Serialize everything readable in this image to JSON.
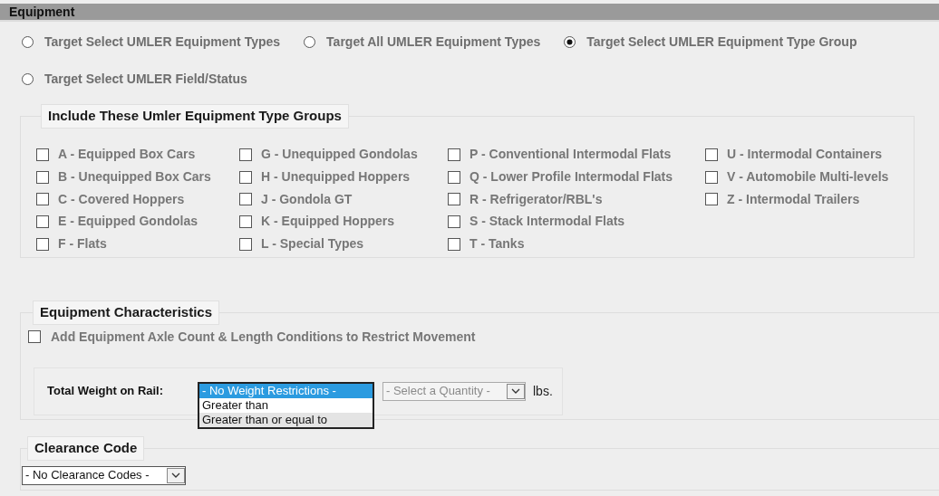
{
  "section_header": "Equipment",
  "target_options": [
    {
      "label": "Target Select UMLER Equipment Types",
      "selected": false
    },
    {
      "label": "Target All UMLER Equipment Types",
      "selected": false
    },
    {
      "label": "Target Select UMLER Equipment Type Group",
      "selected": true
    },
    {
      "label": "Target Select UMLER Field/Status",
      "selected": false
    }
  ],
  "type_groups": {
    "legend": "Include These Umler Equipment Type Groups",
    "columns": [
      {
        "items": [
          {
            "label": "A - Equipped Box Cars",
            "checked": false
          },
          {
            "label": "B - Unequipped Box Cars",
            "checked": false
          },
          {
            "label": "C - Covered Hoppers",
            "checked": false
          },
          {
            "label": "E - Equipped Gondolas",
            "checked": false
          },
          {
            "label": "F - Flats",
            "checked": false
          }
        ]
      },
      {
        "items": [
          {
            "label": "G - Unequipped Gondolas",
            "checked": false
          },
          {
            "label": "H - Unequipped Hoppers",
            "checked": false
          },
          {
            "label": "J - Gondola GT",
            "checked": false
          },
          {
            "label": "K - Equipped Hoppers",
            "checked": false
          },
          {
            "label": "L - Special Types",
            "checked": false
          }
        ]
      },
      {
        "items": [
          {
            "label": "P - Conventional Intermodal Flats",
            "checked": false
          },
          {
            "label": "Q - Lower Profile Intermodal Flats",
            "checked": false
          },
          {
            "label": "R - Refrigerator/RBL's",
            "checked": false
          },
          {
            "label": "S - Stack Intermodal Flats",
            "checked": false
          },
          {
            "label": "T - Tanks",
            "checked": false
          }
        ]
      },
      {
        "items": [
          {
            "label": "U - Intermodal Containers",
            "checked": false
          },
          {
            "label": "V - Automobile Multi-levels",
            "checked": false
          },
          {
            "label": "Z - Intermodal Trailers",
            "checked": false
          }
        ]
      }
    ]
  },
  "characteristics": {
    "legend": "Equipment Characteristics",
    "axle_condition": {
      "label": "Add Equipment Axle Count & Length Conditions to Restrict Movement",
      "checked": false
    },
    "weight": {
      "label": "Total Weight on Rail:",
      "dropdown": {
        "expanded": true,
        "options": [
          {
            "text": "- No Weight Restrictions -",
            "selected": true
          },
          {
            "text": "Greater than",
            "selected": false
          },
          {
            "text": "Greater than or equal to",
            "selected": false
          }
        ]
      },
      "quantity": {
        "value": "- Select a Quantity -",
        "disabled": true
      },
      "unit": "lbs."
    }
  },
  "clearance": {
    "legend": "Clearance Code",
    "select": {
      "value": "- No Clearance Codes -"
    }
  }
}
